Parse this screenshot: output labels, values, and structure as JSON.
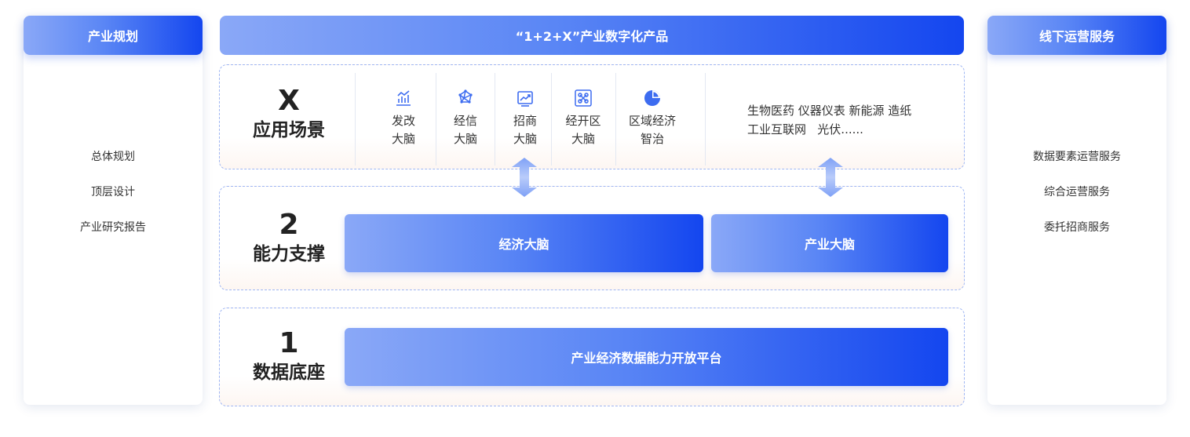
{
  "left_panel": {
    "title": "产业规划",
    "items": [
      "总体规划",
      "顶层设计",
      "产业研究报告"
    ]
  },
  "center": {
    "title": "“1+2+X”产业数字化产品",
    "layer_x": {
      "number": "X",
      "name": "应用场景",
      "scenes": [
        {
          "icon": "bar-chart-icon",
          "label": "发改\n大脑"
        },
        {
          "icon": "network-icon",
          "label": "经信\n大脑"
        },
        {
          "icon": "trend-chart-icon",
          "label": "招商\n大脑"
        },
        {
          "icon": "nodes-icon",
          "label": "经开区\n大脑"
        },
        {
          "icon": "pie-chart-icon",
          "label": "区域经济\n智治"
        }
      ],
      "industries_line1": "生物医药 仪器仪表 新能源 造纸",
      "industries_line2": "工业互联网   光伏......"
    },
    "layer_2": {
      "number": "2",
      "name": "能力支撑",
      "boxes": [
        "经济大脑",
        "产业大脑"
      ]
    },
    "layer_1": {
      "number": "1",
      "name": "数据底座",
      "box": "产业经济数据能力开放平台"
    }
  },
  "right_panel": {
    "title": "线下运营服务",
    "items": [
      "数据要素运营服务",
      "综合运营服务",
      "委托招商服务"
    ]
  },
  "colors": {
    "gradient_start": "#8aa8f7",
    "gradient_end": "#1446ef",
    "dashed_border": "#9fb6f3",
    "icon_blue": "#3d6cf0"
  }
}
